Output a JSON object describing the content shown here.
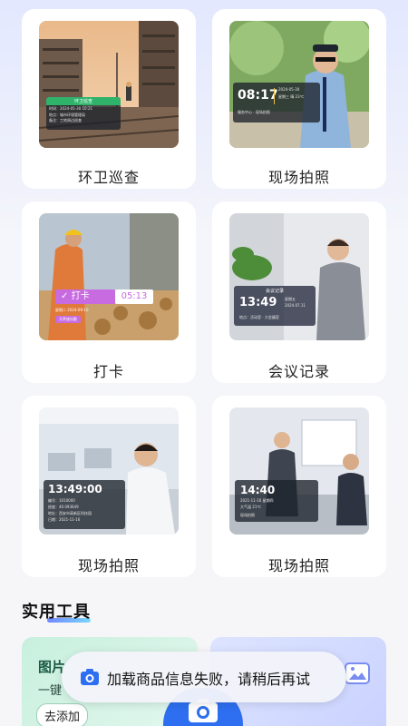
{
  "cards": [
    {
      "label": "环卫巡查",
      "stamp": {
        "head": "环卫巡查",
        "lines": [
          "时间：2024-05-30 10:21",
          "地点：城市环境管理局",
          "备注：工地周边巡查"
        ]
      }
    },
    {
      "label": "现场拍照",
      "stamp": {
        "time": "08:17",
        "date": "2024-05-30",
        "weekday": "星期三 晴 23℃",
        "addr": "服务中心 · 现场拍照"
      }
    },
    {
      "label": "打卡",
      "stamp": {
        "title": "打卡",
        "time": "05:13",
        "date": "星期二 2024-09-10",
        "tag": "天秤座执勤"
      }
    },
    {
      "label": "会议记录",
      "stamp": {
        "head": "会议记录",
        "time": "13:49",
        "side": [
          "星期五",
          "2024.07.11"
        ],
        "addr": "地点：活动室 · 大会議室"
      }
    },
    {
      "label": "现场拍照",
      "stamp": {
        "time": "13:49:00",
        "lines": [
          "编号：1010000",
          "经度：40.093649",
          "地址：西安市高新区科技园",
          "日期：2021-11-16"
        ]
      }
    },
    {
      "label": "现场拍照",
      "stamp": {
        "time": "14:40",
        "line1": "2021-11-16 星期四",
        "line2": "大气温 21℃",
        "line3": "现场拍照"
      }
    }
  ],
  "tools_section": {
    "title": "实用工具"
  },
  "tool_left": {
    "title": "图片",
    "subtitle": "一键",
    "button": "去添加"
  },
  "toast": {
    "text": "加载商品信息失败，请稍后再试"
  },
  "colors": {
    "accent": "#2d6ff0",
    "green_stamp": "#2fb36b",
    "pink_tag": "#c86be0"
  },
  "icons": [
    "camera-icon",
    "image-icon",
    "check-icon"
  ]
}
